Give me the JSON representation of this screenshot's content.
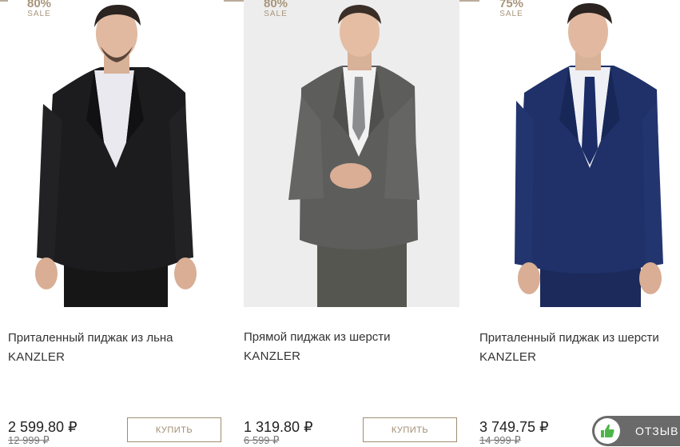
{
  "products": [
    {
      "discount": "80%",
      "sale_label": "SALE",
      "title": "Приталенный пиджак из льна",
      "brand": "KANZLER",
      "price": "2 599.80 ₽",
      "old_price": "12 999 ₽",
      "buy_label": "КУПИТЬ",
      "image": "black-linen-blazer-model",
      "jacket_color": "#1c1c1e",
      "shirt_color": "#e9e9ef"
    },
    {
      "discount": "80%",
      "sale_label": "SALE",
      "title": "Прямой пиджак из шерсти",
      "brand": "KANZLER",
      "price": "1 319.80 ₽",
      "old_price": "6 599 ₽",
      "buy_label": "КУПИТЬ",
      "image": "grey-wool-suit-model",
      "jacket_color": "#5d5e5c",
      "shirt_color": "#f2f2f2"
    },
    {
      "discount": "75%",
      "sale_label": "SALE",
      "title": "Приталенный пиджак из шерсти",
      "brand": "KANZLER",
      "price": "3 749.75 ₽",
      "old_price": "14 999 ₽",
      "buy_label": "",
      "image": "navy-wool-blazer-model",
      "jacket_color": "#1f3168",
      "shirt_color": "#eef0f6"
    }
  ],
  "reviews_widget": {
    "label": "ОТЗЫВ",
    "icon": "thumbs-up-icon"
  },
  "colors": {
    "accent": "#a08c72",
    "badge": "#a8957a",
    "reviews_bg": "#6a6a6a",
    "thumb": "#4db548"
  }
}
